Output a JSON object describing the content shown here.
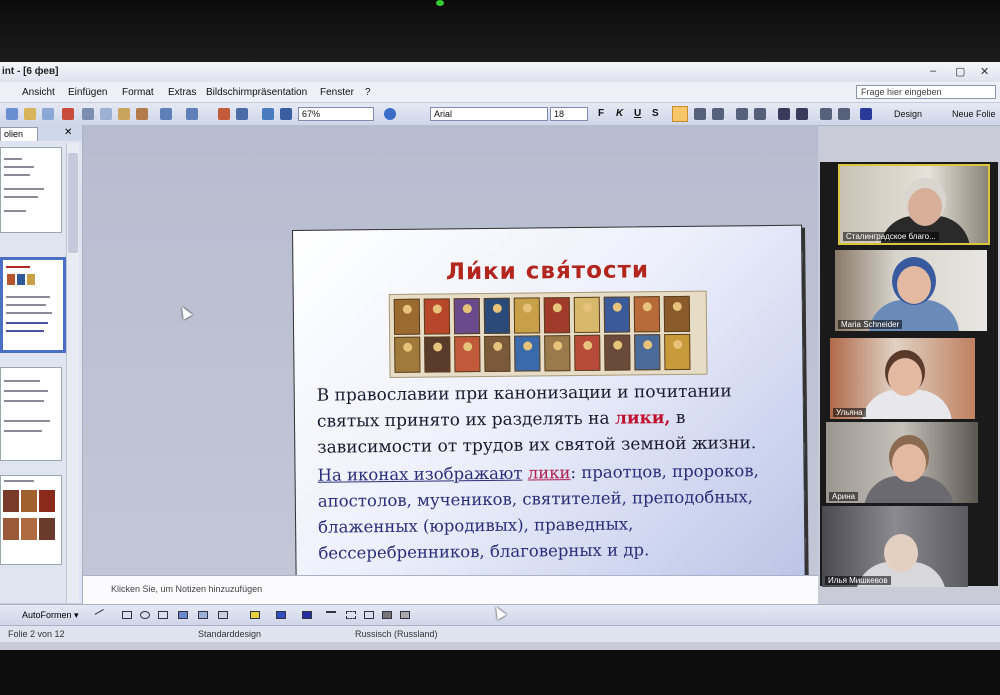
{
  "window": {
    "title": "int - [6 фев]",
    "btn_min": "–",
    "btn_max": "▢",
    "btn_close": "✕"
  },
  "menu": {
    "items": [
      "Ansicht",
      "Einfügen",
      "Format",
      "Extras",
      "Bildschirmpräsentation",
      "Fenster",
      "?"
    ],
    "help_placeholder": "Frage hier eingeben"
  },
  "toolbar": {
    "zoom": "67%",
    "font": "Arial",
    "size": "18",
    "bold": "F",
    "italic": "K",
    "underline": "U",
    "shadow": "S",
    "design_label": "Design",
    "new_slide_label": "Neue Folie"
  },
  "leftpane": {
    "tab_label": "olien",
    "close": "✕"
  },
  "slide": {
    "title": "Ли́ки свя́тости",
    "p1_a": "В православии при  канонизации и почитании святых  принято их разделять на ",
    "p1_hl": "лики,",
    "p1_b": "  в зависимости от трудов их святой земной жизни.",
    "p2_ul": "На иконах изображают",
    "p2_space": " ",
    "p2_lik": "лики",
    "p2_rest": ": праотцов, пророков, апостолов, мучеников, святителей, преподобных, блаженных (юродивых), праведных, бессеребренников, благоверных и др."
  },
  "notes": {
    "placeholder": "Klicken Sie, um Notizen hinzuzufügen"
  },
  "drawbar": {
    "autoshapes": "AutoFormen ▾"
  },
  "status": {
    "slide": "Folie 2 von 12",
    "design": "Standarddesign",
    "language": "Russisch (Russland)"
  },
  "participants": [
    {
      "name": "Сталинградское благо..."
    },
    {
      "name": "Maria Schneider"
    },
    {
      "name": "Ульяна"
    },
    {
      "name": "Арина"
    },
    {
      "name": "Илья Мишкевов"
    }
  ]
}
